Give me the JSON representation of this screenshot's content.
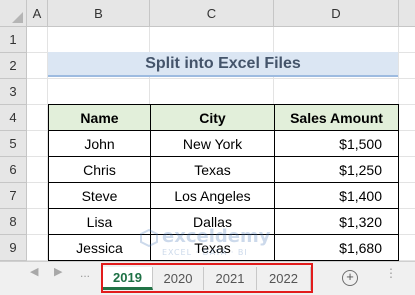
{
  "columns": [
    "A",
    "B",
    "C",
    "D"
  ],
  "rows": [
    "1",
    "2",
    "3",
    "4",
    "5",
    "6",
    "7",
    "8",
    "9"
  ],
  "title": "Split into Excel Files",
  "table": {
    "headers": [
      "Name",
      "City",
      "Sales Amount"
    ],
    "rows": [
      [
        "John",
        "New York",
        "$1,500"
      ],
      [
        "Chris",
        "Texas",
        "$1,250"
      ],
      [
        "Steve",
        "Los Angeles",
        "$1,400"
      ],
      [
        "Lisa",
        "Dallas",
        "$1,320"
      ],
      [
        "Jessica",
        "Texas",
        "$1,680"
      ]
    ]
  },
  "sheet_tabs": [
    "2019",
    "2020",
    "2021",
    "2022"
  ],
  "active_tab": "2019",
  "nav": {
    "prev": "◀",
    "next": "▶",
    "more_left": "...",
    "more_right": "⋮",
    "add": "+"
  },
  "watermark": {
    "name": "exceldemy",
    "sub": "EXCEL · DATA · BI"
  },
  "colors": {
    "header_fill": "#e2efda",
    "title_fill": "#dbe6f3",
    "active_tab_text": "#1e7145",
    "highlight": "#e21c1c"
  }
}
